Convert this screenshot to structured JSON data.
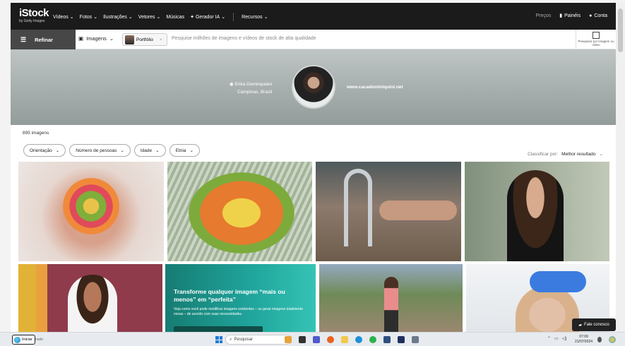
{
  "colors": {
    "nav_bg": "#1b1b1b",
    "refine_bg": "#474747",
    "promo_bg": "#1fa39a",
    "accent_blue": "#1f7ad8"
  },
  "logo": {
    "main": "iStock",
    "sub": "by Getty Images"
  },
  "nav": {
    "items": [
      "Vídeos",
      "Fotos",
      "Ilustrações",
      "Vetores",
      "Músicas",
      "Gerador IA",
      "Recursos"
    ],
    "prices": "Preços",
    "boards": "Painéis",
    "account": "Conta"
  },
  "search": {
    "refine": "Refinar",
    "type": "Imagens",
    "chip": "Portfólio",
    "placeholder": "Pesquise milhões de imagens e vídeos de stock de alta qualidade",
    "visual": "Pesquisar por imagem ou vídeo"
  },
  "profile": {
    "name": "Erika Dominquiani",
    "location": "Campinas, Brazil",
    "website": "www.cacadominiquini.net"
  },
  "results": {
    "count": "895 imagens",
    "filters": [
      "Orientação",
      "Número de pessoas",
      "Idade",
      "Etnia"
    ],
    "sort_label": "Classificar por:",
    "sort_value": "Melhor resultado"
  },
  "promo": {
    "title": "Transforme qualquer imagem “mais ou menos” em “perfeita”",
    "body": "Veja como você pode modificar imagens existentes – ou gerar imagens totalmente novas – de acordo com suas necessidades."
  },
  "chat": "Fale conosco",
  "taskbar": {
    "start": "Iniciar",
    "beside": "rado",
    "search": "Pesquisar",
    "time": "07:09",
    "date": "21/07/2024"
  },
  "icons": [
    "tune-icon",
    "image-icon",
    "close-icon",
    "visual-search-icon",
    "chevron-down-icon",
    "boards-icon",
    "user-icon",
    "camera-icon",
    "chat-icon",
    "search-icon",
    "windows-icon"
  ]
}
